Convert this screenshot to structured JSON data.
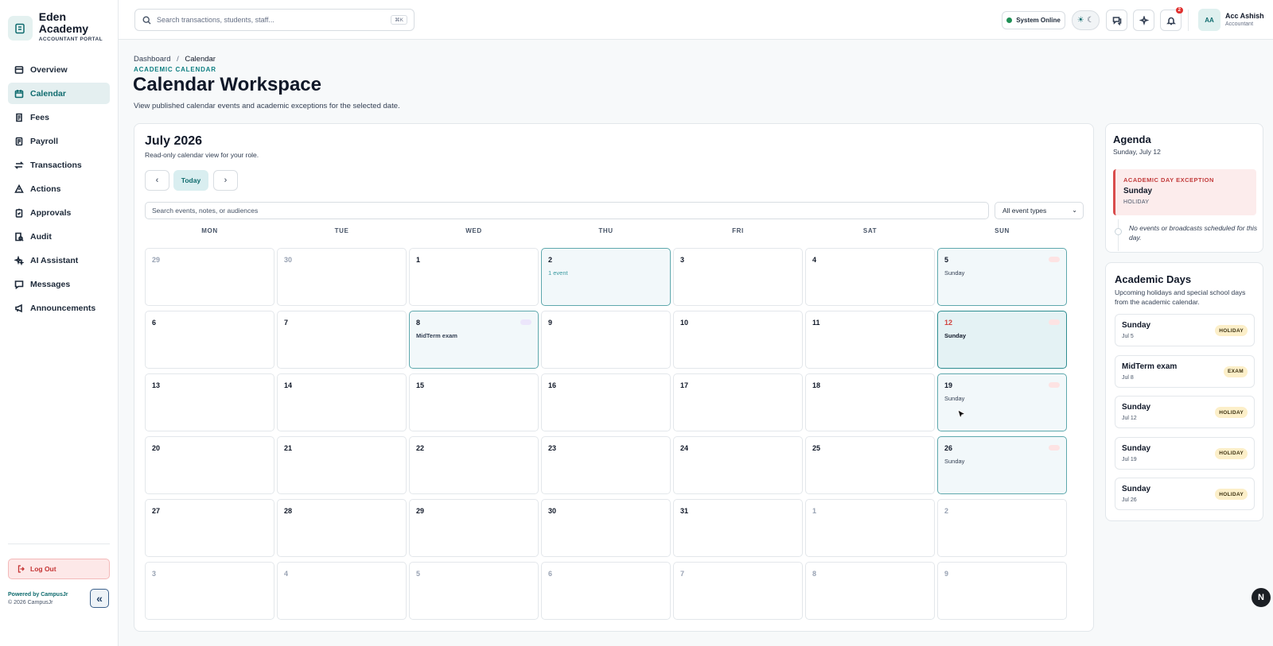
{
  "brand": {
    "name": "Eden Academy",
    "sub": "ACCOUNTANT PORTAL"
  },
  "nav": [
    {
      "label": "Overview",
      "icon": "overview-icon",
      "active": false
    },
    {
      "label": "Calendar",
      "icon": "calendar-icon",
      "active": true
    },
    {
      "label": "Fees",
      "icon": "fees-icon",
      "active": false
    },
    {
      "label": "Payroll",
      "icon": "payroll-icon",
      "active": false
    },
    {
      "label": "Transactions",
      "icon": "transactions-icon",
      "active": false
    },
    {
      "label": "Actions",
      "icon": "warning-icon",
      "active": false
    },
    {
      "label": "Approvals",
      "icon": "clipboard-check-icon",
      "active": false
    },
    {
      "label": "Audit",
      "icon": "audit-icon",
      "active": false
    },
    {
      "label": "AI Assistant",
      "icon": "sparkles-icon",
      "active": false
    },
    {
      "label": "Messages",
      "icon": "message-icon",
      "active": false
    },
    {
      "label": "Announcements",
      "icon": "megaphone-icon",
      "active": false
    }
  ],
  "sidebar_footer": {
    "logout": "Log Out",
    "powered": "Powered by CampusJr",
    "copyright": "© 2026 CampusJr"
  },
  "topbar": {
    "search_placeholder": "Search transactions, students, staff...",
    "shortcut": "⌘K",
    "status": "System Online",
    "notifications": "2",
    "user_initials": "AA",
    "user_name": "Acc Ashish",
    "user_role": "Accountant"
  },
  "page": {
    "breadcrumb_root": "Dashboard",
    "breadcrumb_sep": "/",
    "breadcrumb_current": "Calendar",
    "eyebrow": "ACADEMIC CALENDAR",
    "title": "Calendar Workspace",
    "subtitle": "View published calendar events and academic exceptions for the selected date."
  },
  "calendar": {
    "month": "July 2026",
    "note": "Read-only calendar view for your role.",
    "today": "Today",
    "search_placeholder": "Search events, notes, or audiences",
    "filter": "All event types",
    "weekdays": [
      "MON",
      "TUE",
      "WED",
      "THU",
      "FRI",
      "SAT",
      "SUN"
    ],
    "weeks": [
      [
        {
          "d": "29",
          "other": true
        },
        {
          "d": "30",
          "other": true
        },
        {
          "d": "1"
        },
        {
          "d": "2",
          "label": "1 event",
          "kind": "event"
        },
        {
          "d": "3"
        },
        {
          "d": "4"
        },
        {
          "d": "5",
          "label": "Sunday",
          "kind": "holiday"
        }
      ],
      [
        {
          "d": "6"
        },
        {
          "d": "7"
        },
        {
          "d": "8",
          "label": "MidTerm exam",
          "kind": "exam"
        },
        {
          "d": "9"
        },
        {
          "d": "10"
        },
        {
          "d": "11"
        },
        {
          "d": "12",
          "label": "Sunday",
          "kind": "holiday",
          "selected": true
        }
      ],
      [
        {
          "d": "13"
        },
        {
          "d": "14"
        },
        {
          "d": "15"
        },
        {
          "d": "16"
        },
        {
          "d": "17"
        },
        {
          "d": "18"
        },
        {
          "d": "19",
          "label": "Sunday",
          "kind": "holiday"
        }
      ],
      [
        {
          "d": "20"
        },
        {
          "d": "21"
        },
        {
          "d": "22"
        },
        {
          "d": "23"
        },
        {
          "d": "24"
        },
        {
          "d": "25"
        },
        {
          "d": "26",
          "label": "Sunday",
          "kind": "holiday"
        }
      ],
      [
        {
          "d": "27"
        },
        {
          "d": "28"
        },
        {
          "d": "29"
        },
        {
          "d": "30"
        },
        {
          "d": "31"
        },
        {
          "d": "1",
          "other": true
        },
        {
          "d": "2",
          "other": true
        }
      ],
      [
        {
          "d": "3",
          "other": true
        },
        {
          "d": "4",
          "other": true
        },
        {
          "d": "5",
          "other": true
        },
        {
          "d": "6",
          "other": true
        },
        {
          "d": "7",
          "other": true
        },
        {
          "d": "8",
          "other": true
        },
        {
          "d": "9",
          "other": true
        }
      ]
    ]
  },
  "agenda": {
    "title": "Agenda",
    "date": "Sunday, July 12",
    "exception_kicker": "ACADEMIC DAY EXCEPTION",
    "exception_title": "Sunday",
    "exception_type": "HOLIDAY",
    "empty": "No events or broadcasts scheduled for this day."
  },
  "academic_days": {
    "title": "Academic Days",
    "subtitle": "Upcoming holidays and special school days from the academic calendar.",
    "items": [
      {
        "name": "Sunday",
        "date": "Jul 5",
        "tag": "HOLIDAY"
      },
      {
        "name": "MidTerm exam",
        "date": "Jul 8",
        "tag": "EXAM"
      },
      {
        "name": "Sunday",
        "date": "Jul 12",
        "tag": "HOLIDAY"
      },
      {
        "name": "Sunday",
        "date": "Jul 19",
        "tag": "HOLIDAY"
      },
      {
        "name": "Sunday",
        "date": "Jul 26",
        "tag": "HOLIDAY"
      }
    ]
  },
  "floating_button": "N",
  "colors": {
    "accent": "#0f6b6e",
    "holiday_border": "#5ea8ad",
    "danger": "#d94d4d"
  }
}
